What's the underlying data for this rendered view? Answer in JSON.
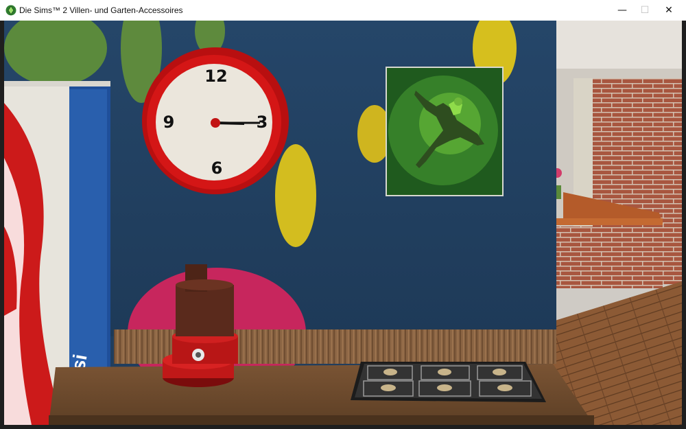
{
  "window": {
    "title": "Die Sims™ 2 Villen- und Garten-Accessoires",
    "controls": {
      "minimize": "—",
      "maximize": "☐",
      "close": "✕"
    }
  },
  "scene": {
    "clock": {
      "numerals": [
        "12",
        "3",
        "6",
        "9"
      ]
    },
    "fridge_logo_text": "pepsi",
    "colors": {
      "wall": "#213e5e",
      "clock_rim": "#d31414",
      "polka_green": "#5d8a3c",
      "polka_yellow": "#d8c21a",
      "polka_pink": "#c8245c",
      "counter_wood": "#6e4c2d",
      "floor_wood": "#8a5a36",
      "brick": "#a3553f"
    }
  }
}
